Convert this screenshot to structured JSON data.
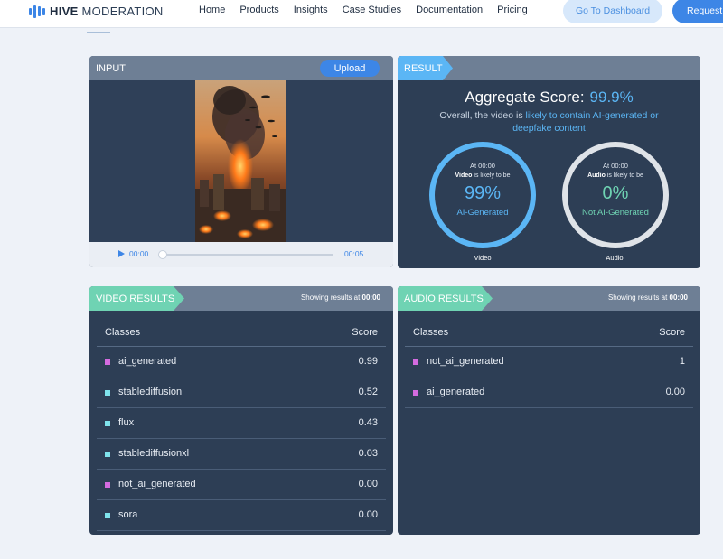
{
  "header": {
    "logo_bold": "HIVE",
    "logo_light": " MODERATION",
    "nav": [
      "Home",
      "Products",
      "Insights",
      "Case Studies",
      "Documentation",
      "Pricing"
    ],
    "dashboard_button": "Go To Dashboard",
    "request_button": "Request"
  },
  "input": {
    "title": "INPUT",
    "upload_label": "Upload",
    "current_time": "00:00",
    "end_time": "00:05"
  },
  "result": {
    "title": "RESULT",
    "aggregate_label": "Aggregate Score:",
    "aggregate_value": "99.9%",
    "summary_prefix": "Overall, the video is ",
    "summary_highlight": "likely to contain AI-generated or deepfake content",
    "video": {
      "at": "At 00:00",
      "likely_bold": "Video",
      "likely_rest": " is likely to be",
      "pct": "99%",
      "label": "AI-Generated",
      "caption": "Video"
    },
    "audio": {
      "at": "At 00:00",
      "likely_bold": "Audio",
      "likely_rest": " is likely to be",
      "pct": "0%",
      "label": "Not AI-Generated",
      "caption": "Audio"
    }
  },
  "video_results": {
    "title": "VIDEO RESULTS",
    "showing_prefix": "Showing results at ",
    "showing_time": "00:00",
    "col_class": "Classes",
    "col_score": "Score",
    "rows": [
      {
        "cls": "ai_generated",
        "score": "0.99",
        "color": "#d46be0"
      },
      {
        "cls": "stablediffusion",
        "score": "0.52",
        "color": "#7fe3ec"
      },
      {
        "cls": "flux",
        "score": "0.43",
        "color": "#7fe3ec"
      },
      {
        "cls": "stablediffusionxl",
        "score": "0.03",
        "color": "#7fe3ec"
      },
      {
        "cls": "not_ai_generated",
        "score": "0.00",
        "color": "#d46be0"
      },
      {
        "cls": "sora",
        "score": "0.00",
        "color": "#7fe3ec"
      }
    ]
  },
  "audio_results": {
    "title": "AUDIO RESULTS",
    "showing_prefix": "Showing results at ",
    "showing_time": "00:00",
    "col_class": "Classes",
    "col_score": "Score",
    "rows": [
      {
        "cls": "not_ai_generated",
        "score": "1",
        "color": "#d46be0"
      },
      {
        "cls": "ai_generated",
        "score": "0.00",
        "color": "#d46be0"
      }
    ]
  },
  "colors": {
    "accent_blue": "#3d86e6",
    "result_blue": "#5bb6f5",
    "result_green": "#6fd3b3",
    "panel_bg": "#2d3e55"
  }
}
